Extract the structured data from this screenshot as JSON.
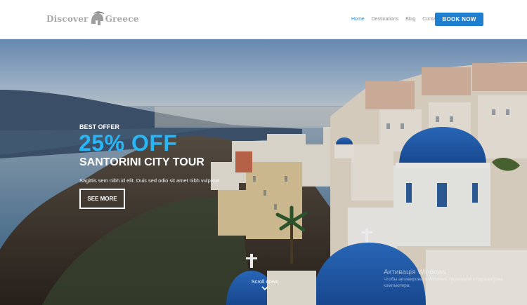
{
  "header": {
    "logo_left": "Discover",
    "logo_right": "Greece",
    "nav": [
      "Home",
      "Destinations",
      "Blog",
      "Contact"
    ],
    "active_nav": "Home",
    "book_label": "BOOK NOW"
  },
  "hero": {
    "best_offer": "BEST OFFER",
    "discount": "25% OFF",
    "title": "SANTORINI CITY TOUR",
    "description": "Sagittis sem nibh id elit. Duis sed odio sit amet nibh vulputat",
    "cta_label": "SEE MORE",
    "scroll_label": "Scroll down"
  },
  "watermark": {
    "title": "Активація Windows",
    "line1": "Чтобы активировать Windows, перейдите к параметрам",
    "line2": "компьютера."
  },
  "colors": {
    "accent": "#1e7fd1",
    "discount_text": "#29b6f6",
    "dome_blue": "#1f5fb4"
  },
  "icons": {
    "logo": "spartan-helmet-icon",
    "scroll": "chevron-down-icon"
  }
}
